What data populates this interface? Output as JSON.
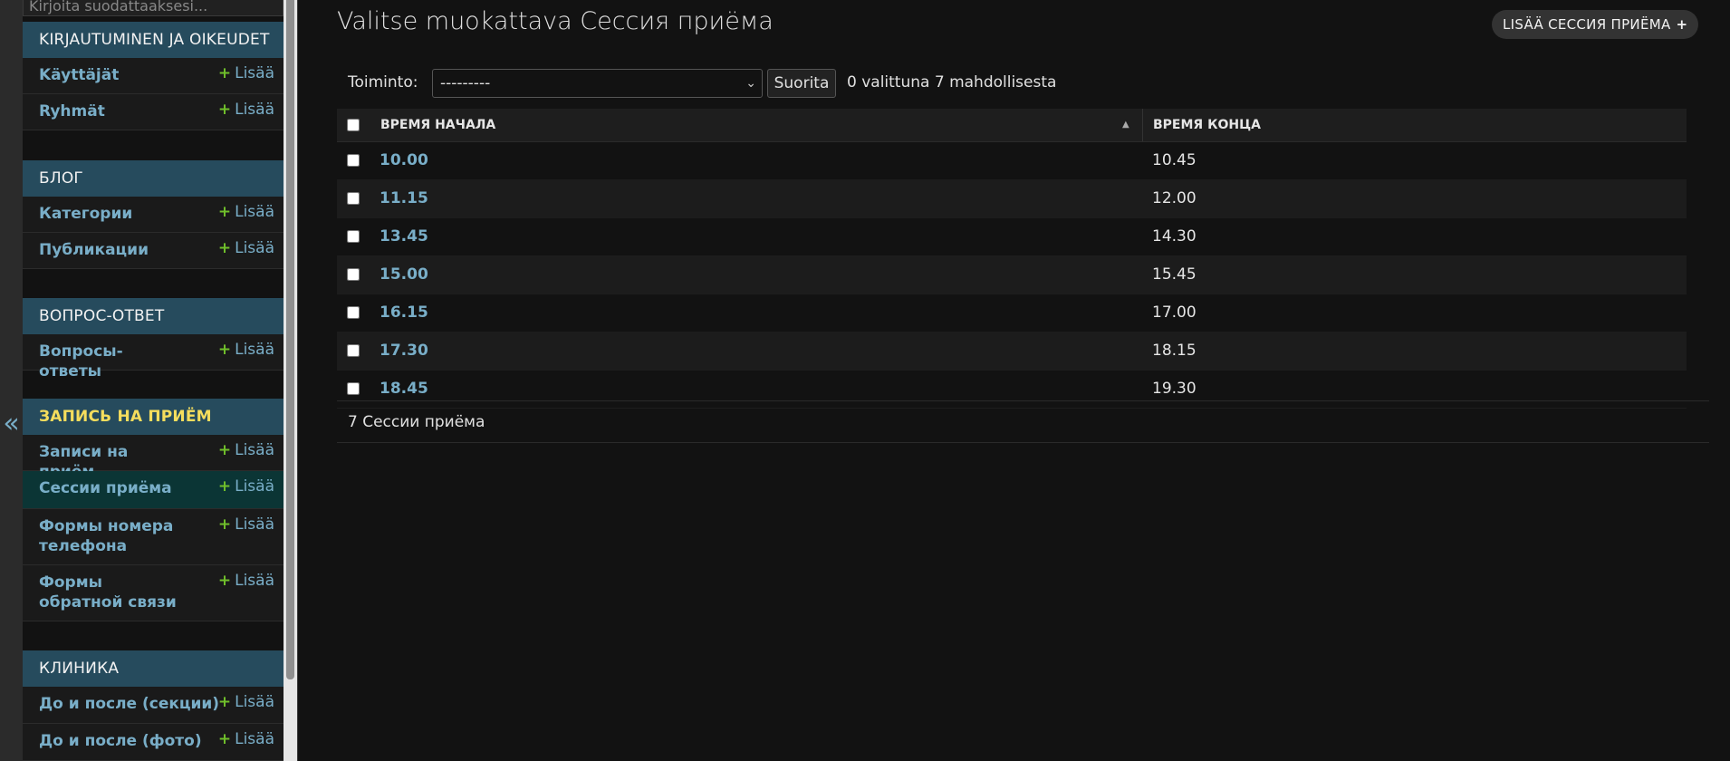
{
  "sidebar": {
    "filter_placeholder": "Kirjoita suodattaaksesi...",
    "collapse_glyph": "«",
    "add_label": "Lisää",
    "add_glyph": "+",
    "modules": [
      {
        "caption": "KIRJAUTUMINEN JA OIKEUDET",
        "models": [
          "Käyttäjät",
          "Ryhmät"
        ]
      },
      {
        "caption": "БЛОГ",
        "models": [
          "Категории",
          "Публикации"
        ]
      },
      {
        "caption": "ВОПРОС-ОТВЕТ",
        "models": [
          "Вопросы-ответы"
        ]
      },
      {
        "caption": "ЗАПИСЬ НА ПРИЁМ",
        "models": [
          "Записи на приём",
          "Сессии приёма",
          "Формы номера телефона",
          "Формы обратной связи"
        ]
      },
      {
        "caption": "КЛИНИКА",
        "models": [
          "До и после (секции)",
          "До и после (фото)"
        ]
      }
    ]
  },
  "header": {
    "title": "Valitse muokattava Сессия приёма",
    "add_button": "LISÄÄ СЕССИЯ ПРИЁМА",
    "add_icon": "+"
  },
  "actions": {
    "label": "Toiminto:",
    "select_value": "---------",
    "go_label": "Suorita",
    "counter": "0 valittuna 7 mahdollisesta"
  },
  "table": {
    "columns": [
      "ВРЕМЯ НАЧАЛА",
      "ВРЕМЯ КОНЦА"
    ],
    "sort_glyph": "▲",
    "rows": [
      {
        "start": "10.00",
        "end": "10.45"
      },
      {
        "start": "11.15",
        "end": "12.00"
      },
      {
        "start": "13.45",
        "end": "14.30"
      },
      {
        "start": "15.00",
        "end": "15.45"
      },
      {
        "start": "16.15",
        "end": "17.00"
      },
      {
        "start": "17.30",
        "end": "18.15"
      },
      {
        "start": "18.45",
        "end": "19.30"
      }
    ]
  },
  "paginator": {
    "text": "7 Сессии приёма"
  },
  "colors": {
    "accent": "#79aec8",
    "module_header": "#264b5d",
    "selected_row": "#0b3535",
    "add_plus": "#70bf2b"
  }
}
